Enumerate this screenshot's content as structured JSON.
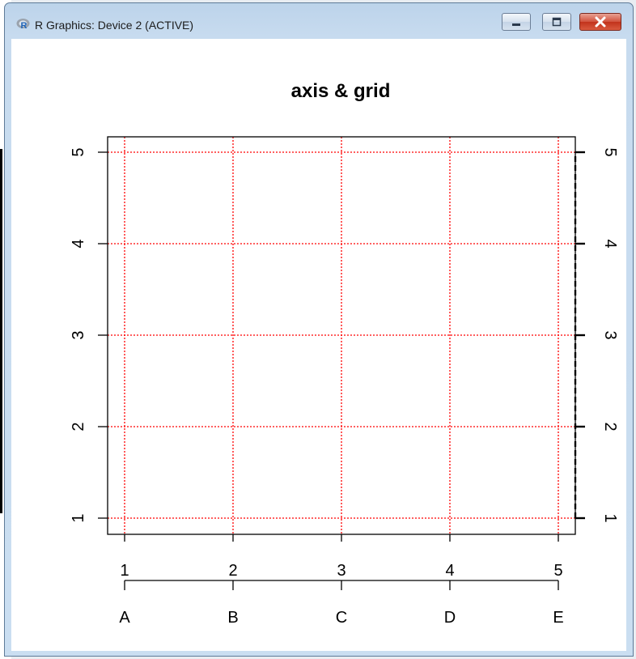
{
  "window": {
    "title": "R Graphics: Device 2 (ACTIVE)",
    "icon": "r-logo-icon",
    "controls": {
      "minimize": "minimize-icon",
      "maximize": "maximize-icon",
      "close": "close-icon"
    }
  },
  "chart_data": {
    "type": "scatter",
    "title": "axis & grid",
    "xlabel": "",
    "ylabel": "",
    "xlim": [
      1,
      5
    ],
    "ylim": [
      1,
      5
    ],
    "points": [],
    "grid": {
      "on": true,
      "color": "#ff0000",
      "style": "dotted",
      "x": [
        1,
        2,
        3,
        4,
        5
      ],
      "y": [
        1,
        2,
        3,
        4,
        5
      ]
    },
    "axes": {
      "bottom": {
        "ticks": [
          1,
          2,
          3,
          4,
          5
        ],
        "labels": [
          "1",
          "2",
          "3",
          "4",
          "5"
        ]
      },
      "bottom_outer": {
        "ticks": [
          1,
          2,
          3,
          4,
          5
        ],
        "labels": [
          "A",
          "B",
          "C",
          "D",
          "E"
        ]
      },
      "left": {
        "ticks": [
          1,
          2,
          3,
          4,
          5
        ],
        "labels": [
          "1",
          "2",
          "3",
          "4",
          "5"
        ]
      },
      "right": {
        "ticks": [
          1,
          2,
          3,
          4,
          5
        ],
        "labels": [
          "1",
          "2",
          "3",
          "4",
          "5"
        ],
        "line_style": "dashed"
      }
    },
    "colors": {
      "grid": "#ff0000",
      "axis": "#000000",
      "text": "#000000"
    }
  }
}
